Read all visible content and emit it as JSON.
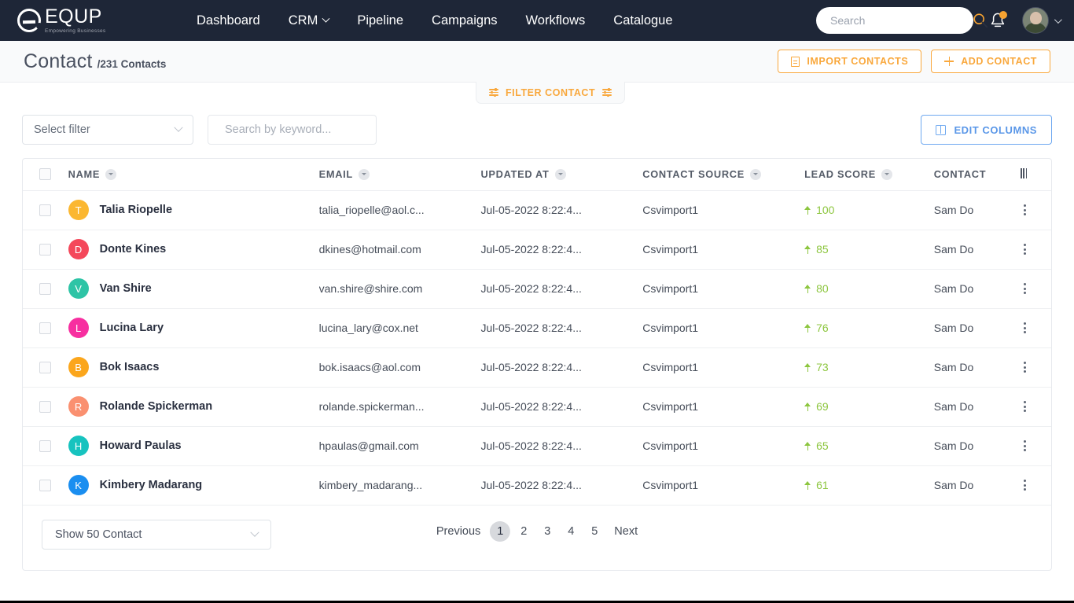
{
  "brand": {
    "name": "EQUP",
    "tagline": "Empowering Businesses"
  },
  "nav": {
    "items": [
      {
        "label": "Dashboard",
        "has_caret": false
      },
      {
        "label": "CRM",
        "has_caret": true
      },
      {
        "label": "Pipeline",
        "has_caret": false
      },
      {
        "label": "Campaigns",
        "has_caret": false
      },
      {
        "label": "Workflows",
        "has_caret": false
      },
      {
        "label": "Catalogue",
        "has_caret": false
      }
    ]
  },
  "search": {
    "value": "",
    "placeholder": "Search",
    "icon": "search-icon"
  },
  "notifications": {
    "icon": "bell-icon",
    "has_unread_dot": true,
    "dot_color": "#f7a331"
  },
  "account": {
    "icon": "avatar",
    "caret": "chevron-down-icon"
  },
  "page": {
    "title": "Contact",
    "subtitle": "/231 Contacts",
    "count": 231
  },
  "header_actions": {
    "import_label": "IMPORT CONTACTS",
    "import_icon": "document-icon",
    "add_label": "ADD CONTACT",
    "add_icon": "plus-icon",
    "accent": "#f9a83d"
  },
  "filter_tab": {
    "label": "FILTER CONTACT",
    "icon_left": "filter-icon",
    "icon_right": "filter-icon"
  },
  "toolbar": {
    "select_filter": {
      "value": "Select filter",
      "caret": "chevron-down-icon"
    },
    "keyword_search": {
      "value": "",
      "placeholder": "Search by keyword...",
      "icon": "search-icon"
    },
    "edit_columns": {
      "label": "EDIT COLUMNS",
      "icon": "columns-icon",
      "accent": "#5a97e8"
    }
  },
  "table": {
    "columns": [
      {
        "label": "NAME",
        "sortable": true
      },
      {
        "label": "EMAIL",
        "sortable": true
      },
      {
        "label": "UPDATED AT",
        "sortable": true
      },
      {
        "label": "CONTACT SOURCE",
        "sortable": true
      },
      {
        "label": "LEAD SCORE",
        "sortable": true
      },
      {
        "label": "CONTACT",
        "sortable": false,
        "truncated": true
      }
    ],
    "resize_handle_icon": "column-resize-icon",
    "rows": [
      {
        "initial": "T",
        "color": "#fbb731",
        "name": "Talia Riopelle",
        "email": "talia_riopelle@aol.c...",
        "updated_at": "Jul-05-2022 8:22:4...",
        "source": "Csvimport1",
        "lead_score": "100",
        "owner": "Sam Do"
      },
      {
        "initial": "D",
        "color": "#f4485b",
        "name": "Donte Kines",
        "email": "dkines@hotmail.com",
        "updated_at": "Jul-05-2022 8:22:4...",
        "source": "Csvimport1",
        "lead_score": "85",
        "owner": "Sam Do"
      },
      {
        "initial": "V",
        "color": "#2ec4a6",
        "name": "Van Shire",
        "email": "van.shire@shire.com",
        "updated_at": "Jul-05-2022 8:22:4...",
        "source": "Csvimport1",
        "lead_score": "80",
        "owner": "Sam Do"
      },
      {
        "initial": "L",
        "color": "#f72fa0",
        "name": "Lucina Lary",
        "email": "lucina_lary@cox.net",
        "updated_at": "Jul-05-2022 8:22:4...",
        "source": "Csvimport1",
        "lead_score": "76",
        "owner": "Sam Do"
      },
      {
        "initial": "B",
        "color": "#fba61c",
        "name": "Bok Isaacs",
        "email": "bok.isaacs@aol.com",
        "updated_at": "Jul-05-2022 8:22:4...",
        "source": "Csvimport1",
        "lead_score": "73",
        "owner": "Sam Do"
      },
      {
        "initial": "R",
        "color": "#fa9070",
        "name": "Rolande Spickerman",
        "email": "rolande.spickerman...",
        "updated_at": "Jul-05-2022 8:22:4...",
        "source": "Csvimport1",
        "lead_score": "69",
        "owner": "Sam Do"
      },
      {
        "initial": "H",
        "color": "#17c3bf",
        "name": "Howard Paulas",
        "email": "hpaulas@gmail.com",
        "updated_at": "Jul-05-2022 8:22:4...",
        "source": "Csvimport1",
        "lead_score": "65",
        "owner": "Sam Do"
      },
      {
        "initial": "K",
        "color": "#1a8ef0",
        "name": "Kimbery Madarang",
        "email": "kimbery_madarang...",
        "updated_at": "Jul-05-2022 8:22:4...",
        "source": "Csvimport1",
        "lead_score": "61",
        "owner": "Sam Do"
      }
    ],
    "score_color": "#8dc63f",
    "row_menu_icon": "kebab-menu-icon"
  },
  "footer": {
    "page_size": {
      "value": "Show 50 Contact",
      "caret": "chevron-down-icon"
    },
    "pagination": {
      "previous_label": "Previous",
      "next_label": "Next",
      "pages": [
        "1",
        "2",
        "3",
        "4",
        "5"
      ],
      "active_page": "1"
    }
  }
}
